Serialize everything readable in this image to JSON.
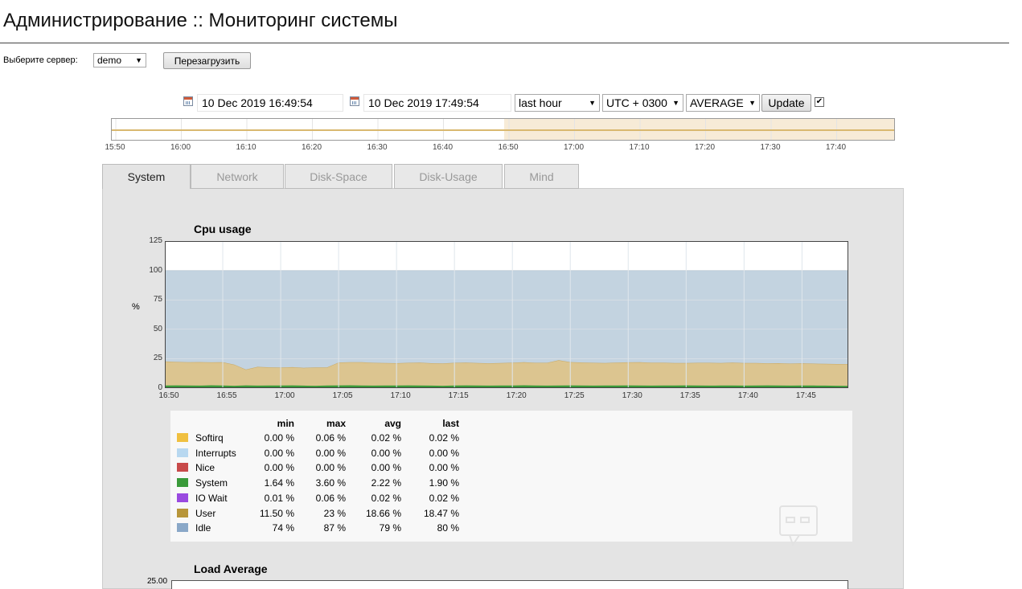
{
  "page": {
    "title": "Администрирование :: Мониторинг системы"
  },
  "server": {
    "label": "Выберите сервер:",
    "selected": "demo",
    "reload_label": "Перезагрузить"
  },
  "range": {
    "from": "10 Dec 2019 16:49:54",
    "to": "10 Dec 2019 17:49:54",
    "period": "last hour",
    "timezone": "UTC + 0300",
    "aggregation": "AVERAGE",
    "update_label": "Update",
    "checkbox_checked": true,
    "checkbox_mark": "✔"
  },
  "timeline": {
    "ticks": [
      "15:50",
      "16:00",
      "16:10",
      "16:20",
      "16:30",
      "16:40",
      "16:50",
      "17:00",
      "17:10",
      "17:20",
      "17:30",
      "17:40"
    ],
    "selected_start_fraction": 0.5,
    "selected_color": "#f7ebd7"
  },
  "tabs": [
    {
      "label": "System",
      "active": true
    },
    {
      "label": "Network",
      "active": false
    },
    {
      "label": "Disk-Space",
      "active": false
    },
    {
      "label": "Disk-Usage",
      "active": false
    },
    {
      "label": "Mind",
      "active": false
    }
  ],
  "cpu_chart": {
    "title": "Cpu usage",
    "ylabel": "%"
  },
  "load_chart": {
    "title": "Load Average",
    "y_top_label": "25.00"
  },
  "legend": {
    "headers": [
      "min",
      "max",
      "avg",
      "last"
    ],
    "rows": [
      {
        "name": "Softirq",
        "color": "#f0c040",
        "min": "0.00 %",
        "max": "0.06 %",
        "avg": "0.02 %",
        "last": "0.02 %"
      },
      {
        "name": "Interrupts",
        "color": "#b8d8f0",
        "min": "0.00 %",
        "max": "0.00 %",
        "avg": "0.00 %",
        "last": "0.00 %"
      },
      {
        "name": "Nice",
        "color": "#c84a4a",
        "min": "0.00 %",
        "max": "0.00 %",
        "avg": "0.00 %",
        "last": "0.00 %"
      },
      {
        "name": "System",
        "color": "#3a9a3a",
        "min": "1.64 %",
        "max": "3.60 %",
        "avg": "2.22 %",
        "last": "1.90 %"
      },
      {
        "name": "IO Wait",
        "color": "#9a4ae0",
        "min": "0.01 %",
        "max": "0.06 %",
        "avg": "0.02 %",
        "last": "0.02 %"
      },
      {
        "name": "User",
        "color": "#b8963a",
        "min": "11.50 %",
        "max": "23 %",
        "avg": "18.66 %",
        "last": "18.47 %"
      },
      {
        "name": "Idle",
        "color": "#8aa8c8",
        "min": "74 %",
        "max": "87 %",
        "avg": "79 %",
        "last": "80 %"
      }
    ]
  },
  "chart_data": [
    {
      "type": "area",
      "title": "Cpu usage",
      "ylabel": "%",
      "xlabel": "",
      "ylim": [
        0,
        125
      ],
      "yticks": [
        0,
        25,
        50,
        75,
        100,
        125
      ],
      "x_ticks": [
        "16:50",
        "16:55",
        "17:00",
        "17:05",
        "17:10",
        "17:15",
        "17:20",
        "17:25",
        "17:30",
        "17:35",
        "17:40",
        "17:45"
      ],
      "grid": true,
      "x": [
        "16:50",
        "16:51",
        "16:52",
        "16:53",
        "16:54",
        "16:55",
        "16:56",
        "16:57",
        "16:58",
        "16:59",
        "17:00",
        "17:01",
        "17:02",
        "17:03",
        "17:04",
        "17:05",
        "17:06",
        "17:07",
        "17:08",
        "17:09",
        "17:10",
        "17:11",
        "17:12",
        "17:13",
        "17:14",
        "17:15",
        "17:16",
        "17:17",
        "17:18",
        "17:19",
        "17:20",
        "17:21",
        "17:22",
        "17:23",
        "17:24",
        "17:25",
        "17:26",
        "17:27",
        "17:28",
        "17:29",
        "17:30",
        "17:31",
        "17:32",
        "17:33",
        "17:34",
        "17:35",
        "17:36",
        "17:37",
        "17:38",
        "17:39",
        "17:40",
        "17:41",
        "17:42",
        "17:43",
        "17:44",
        "17:45",
        "17:46",
        "17:47",
        "17:48",
        "17:49"
      ],
      "series": [
        {
          "name": "System",
          "color": "#3a9a3a",
          "values": [
            2.2,
            2.3,
            2.2,
            2.1,
            2.4,
            2.2,
            2.0,
            2.3,
            2.1,
            2.2,
            2.2,
            2.3,
            2.1,
            2.0,
            2.2,
            2.3,
            2.4,
            2.2,
            2.1,
            2.2,
            2.2,
            2.3,
            2.2,
            2.1,
            2.0,
            2.2,
            2.3,
            2.2,
            2.1,
            2.2,
            2.2,
            2.4,
            2.2,
            2.1,
            2.2,
            2.3,
            2.2,
            2.1,
            2.2,
            2.2,
            2.3,
            2.2,
            2.1,
            2.2,
            2.2,
            2.3,
            2.2,
            2.1,
            2.2,
            2.2,
            2.1,
            2.2,
            2.3,
            2.2,
            2.1,
            2.2,
            2.2,
            2.1,
            2.0,
            1.9
          ]
        },
        {
          "name": "User",
          "color": "#dcc590",
          "values": [
            20.5,
            20,
            19.8,
            20,
            19.5,
            19.8,
            18,
            13.5,
            16,
            15.5,
            15.3,
            15.5,
            15.2,
            15.6,
            15.4,
            19.5,
            19.6,
            19.8,
            19.4,
            19.2,
            19.0,
            19.2,
            19.5,
            19.1,
            19.0,
            19.3,
            19.4,
            19.1,
            19.0,
            19.2,
            19.4,
            19.6,
            19.3,
            19.4,
            21.5,
            19.8,
            19.6,
            19.4,
            19.2,
            19.5,
            19.6,
            19.8,
            19.5,
            19.4,
            19.2,
            19.0,
            19.3,
            19.4,
            19.2,
            19.5,
            19.3,
            19.2,
            18.8,
            19.0,
            18.7,
            18.9,
            18.6,
            18.5,
            18.5,
            18.5
          ]
        },
        {
          "name": "Idle",
          "color": "#c3d3e0",
          "values": [
            77.3,
            77.7,
            78,
            77.9,
            78.1,
            78,
            80,
            84.2,
            81.9,
            82.3,
            82.5,
            82.2,
            82.7,
            82.4,
            82.4,
            78.2,
            78,
            78,
            78.5,
            78.6,
            78.8,
            78.5,
            78.3,
            78.8,
            79,
            78.5,
            78.3,
            78.7,
            78.9,
            78.6,
            78.4,
            78,
            78.5,
            78.5,
            76.3,
            77.9,
            78.2,
            78.5,
            78.6,
            78.3,
            78.1,
            78,
            78.4,
            78.4,
            78.6,
            78.7,
            78.5,
            78.5,
            78.6,
            78.3,
            78.6,
            78.6,
            78.9,
            78.8,
            79.2,
            78.9,
            79.2,
            79.4,
            79.5,
            79.6
          ]
        }
      ]
    }
  ]
}
